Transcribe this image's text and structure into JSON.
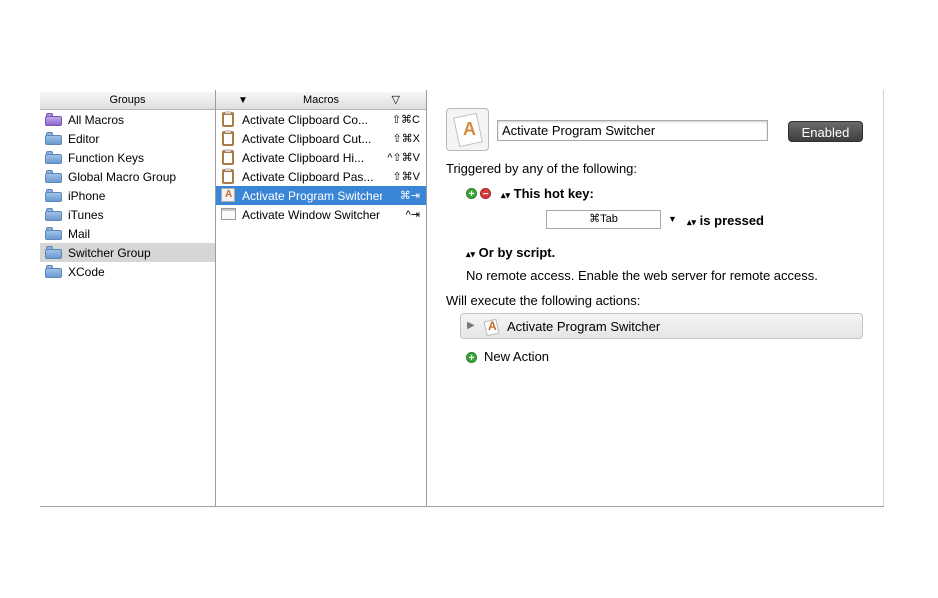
{
  "groups": {
    "header": "Groups",
    "items": [
      {
        "label": "All Macros",
        "icon": "smart-folder-icon"
      },
      {
        "label": "Editor",
        "icon": "folder-icon"
      },
      {
        "label": "Function Keys",
        "icon": "folder-icon"
      },
      {
        "label": "Global Macro Group",
        "icon": "folder-icon"
      },
      {
        "label": "iPhone",
        "icon": "folder-icon"
      },
      {
        "label": "iTunes",
        "icon": "folder-icon"
      },
      {
        "label": "Mail",
        "icon": "folder-icon"
      },
      {
        "label": "Switcher Group",
        "icon": "folder-icon",
        "selected": true
      },
      {
        "label": "XCode",
        "icon": "folder-icon"
      }
    ]
  },
  "macros": {
    "header": "Macros",
    "sort_left": "▼",
    "sort_right": "▽",
    "items": [
      {
        "label": "Activate Clipboard Co...",
        "shortcut": "⇧⌘C",
        "icon": "clipboard-icon"
      },
      {
        "label": "Activate Clipboard Cut...",
        "shortcut": "⇧⌘X",
        "icon": "clipboard-icon"
      },
      {
        "label": "Activate Clipboard Hi...",
        "shortcut": "^⇧⌘V",
        "icon": "clipboard-icon"
      },
      {
        "label": "Activate Clipboard Pas...",
        "shortcut": "⇧⌘V",
        "icon": "clipboard-icon"
      },
      {
        "label": "Activate Program Switcher",
        "shortcut": "⌘⇥",
        "icon": "app-icon",
        "selected": true
      },
      {
        "label": "Activate Window Switcher",
        "shortcut": "^⇥",
        "icon": "window-icon"
      }
    ]
  },
  "editor": {
    "macro_name": "Activate Program Switcher",
    "enabled_label": "Enabled",
    "triggered_label": "Triggered by any of the following:",
    "add_symbol": "+",
    "remove_symbol": "−",
    "updown_symbol": "▴▾",
    "hotkey_label": "This hot key:",
    "hotkey_value": "⌘Tab",
    "dropdown_symbol": "▼",
    "pressed_label": "is pressed",
    "script_label": "Or by script.",
    "remote_text": "No remote access.  Enable the web server for remote access.",
    "actions_label": "Will execute the following actions:",
    "action_triangle": "▶",
    "action_name": "Activate Program Switcher",
    "new_action_label": "New Action"
  }
}
